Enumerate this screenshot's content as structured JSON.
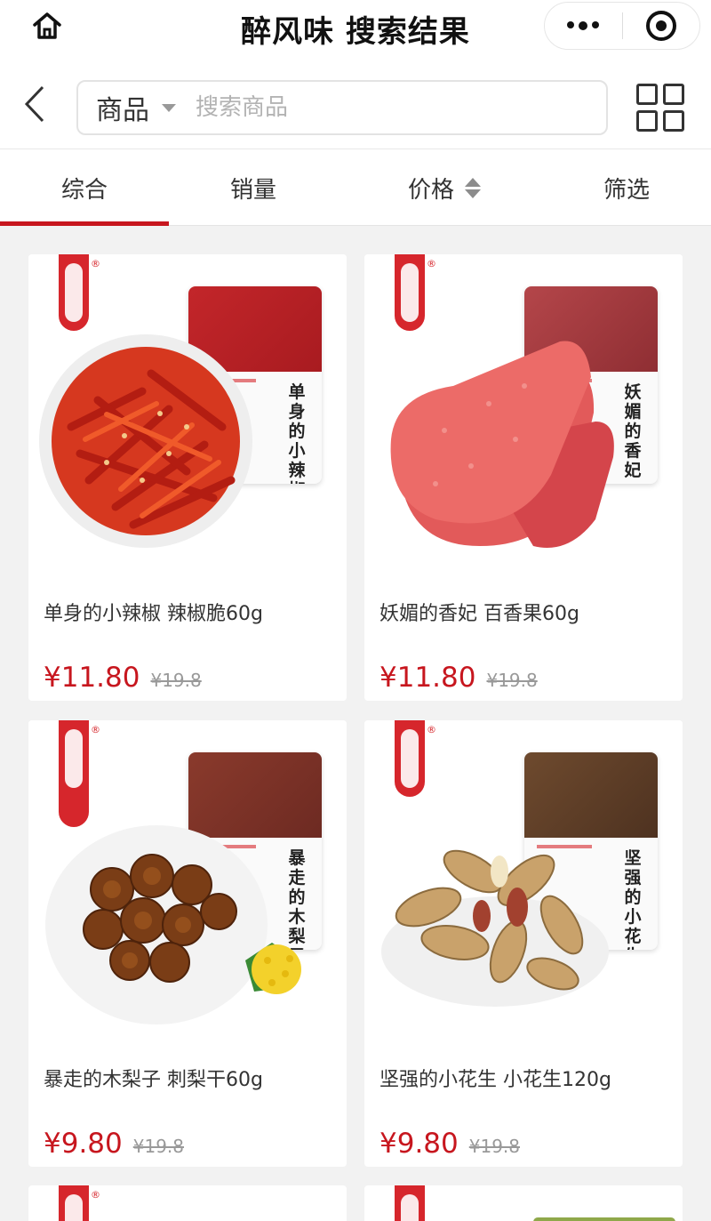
{
  "header": {
    "title": "醉风味 搜索结果",
    "home_icon": "home-icon",
    "more_icon": "more-dots-icon",
    "close_icon": "target-icon"
  },
  "search": {
    "scope": "商品",
    "placeholder": "搜索商品"
  },
  "tabs": [
    {
      "label": "综合",
      "active": true
    },
    {
      "label": "销量",
      "active": false
    },
    {
      "label": "价格",
      "active": false
    },
    {
      "label": "筛选",
      "active": false
    }
  ],
  "products": [
    {
      "name": "单身的小辣椒 辣椒脆60g",
      "price": "¥11.80",
      "original_price": "¥19.8",
      "bag_label": "单身的小辣椒"
    },
    {
      "name": "妖媚的香妃 百香果60g",
      "price": "¥11.80",
      "original_price": "¥19.8",
      "bag_label": "妖媚的香妃"
    },
    {
      "name": "暴走的木梨子 刺梨干60g",
      "price": "¥9.80",
      "original_price": "¥19.8",
      "bag_label": "暴走的木梨子"
    },
    {
      "name": "坚强的小花生 小花生120g",
      "price": "¥9.80",
      "original_price": "¥19.8",
      "bag_label": "坚强的小花生"
    }
  ],
  "colors": {
    "accent": "#c7161e",
    "ribbon": "#d6262c",
    "background": "#f2f2f2"
  }
}
